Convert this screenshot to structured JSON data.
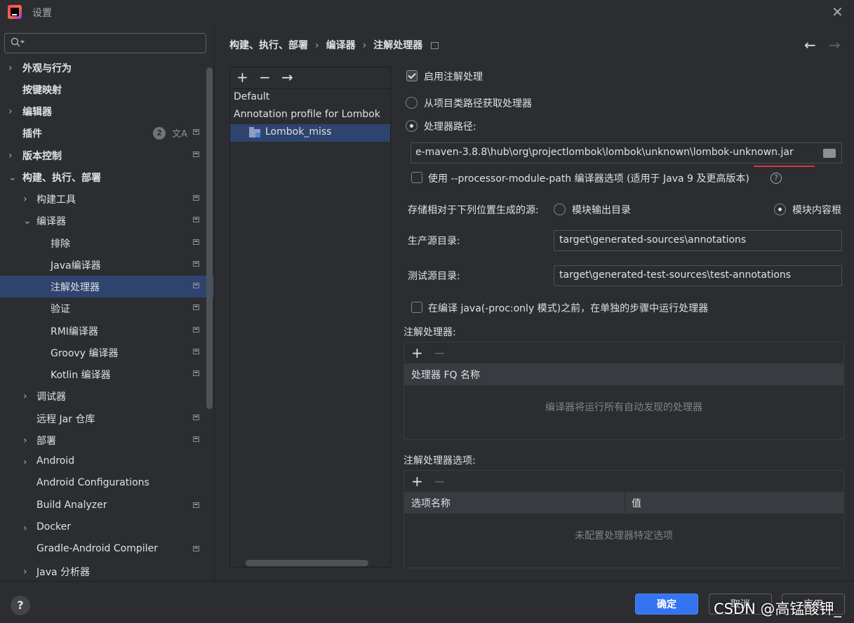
{
  "window": {
    "title": "设置"
  },
  "search": {
    "placeholder": ""
  },
  "sidebar": {
    "items": [
      {
        "label": "外观与行为",
        "chevron": "right"
      },
      {
        "label": "按键映射"
      },
      {
        "label": "编辑器",
        "chevron": "right"
      },
      {
        "label": "插件",
        "badge": "2"
      },
      {
        "label": "版本控制",
        "chevron": "right"
      },
      {
        "label": "构建、执行、部署",
        "chevron": "down"
      },
      {
        "label": "构建工具",
        "chevron": "right"
      },
      {
        "label": "编译器",
        "chevron": "down"
      },
      {
        "label": "排除"
      },
      {
        "label": "Java编译器"
      },
      {
        "label": "注解处理器",
        "selected": true
      },
      {
        "label": "验证"
      },
      {
        "label": "RMI编译器"
      },
      {
        "label": "Groovy 编译器"
      },
      {
        "label": "Kotlin 编译器"
      },
      {
        "label": "调试器",
        "chevron": "right"
      },
      {
        "label": "远程 Jar 仓库"
      },
      {
        "label": "部署",
        "chevron": "right"
      },
      {
        "label": "Android",
        "chevron": "right"
      },
      {
        "label": "Android Configurations"
      },
      {
        "label": "Build Analyzer"
      },
      {
        "label": "Docker",
        "chevron": "right"
      },
      {
        "label": "Gradle-Android Compiler"
      },
      {
        "label": "Java 分析器",
        "chevron": "right"
      }
    ]
  },
  "breadcrumb": [
    "构建、执行、部署",
    "编译器",
    "注解处理器"
  ],
  "profiles": {
    "toolbar": {
      "add": "+",
      "remove": "−",
      "move": "→"
    },
    "items": [
      "Default",
      "Annotation profile for Lombok",
      "Lombok_miss"
    ]
  },
  "settings": {
    "enable_label": "启用注解处理",
    "enable_checked": true,
    "from_classpath_label": "从项目类路径获取处理器",
    "processor_path_label": "处理器路径:",
    "processor_path_value": "e-maven-3.8.8\\hub\\org\\projectlombok\\lombok\\unknown\\lombok-unknown.jar",
    "module_path_label": "使用 --processor-module-path 编译器选项 (适用于 Java 9 及更高版本)",
    "store_label": "存储相对于下列位置生成的源:",
    "module_output_label": "模块输出目录",
    "module_content_label": "模块内容根",
    "prod_dir_label": "生产源目录:",
    "prod_dir_value": "target\\generated-sources\\annotations",
    "test_dir_label": "测试源目录:",
    "test_dir_value": "target\\generated-test-sources\\test-annotations",
    "separate_step_label": "在编译 java(-proc:only 模式)之前，在单独的步骤中运行处理器"
  },
  "processors_table": {
    "title": "注解处理器:",
    "column": "处理器 FQ 名称",
    "empty_text": "编译器将运行所有自动发现的处理器"
  },
  "options_table": {
    "title": "注解处理器选项:",
    "columns": [
      "选项名称",
      "值"
    ],
    "empty_text": "未配置处理器特定选项"
  },
  "bottom": {
    "help": "?",
    "ok": "确定",
    "cancel": "取消",
    "apply": "应用"
  },
  "watermark": "CSDN @高锰酸钾_",
  "colors": {
    "background": "#2b2d30",
    "selection": "#2e436e",
    "primary_button": "#3574f0",
    "annotation_red": "#d93a3a"
  }
}
